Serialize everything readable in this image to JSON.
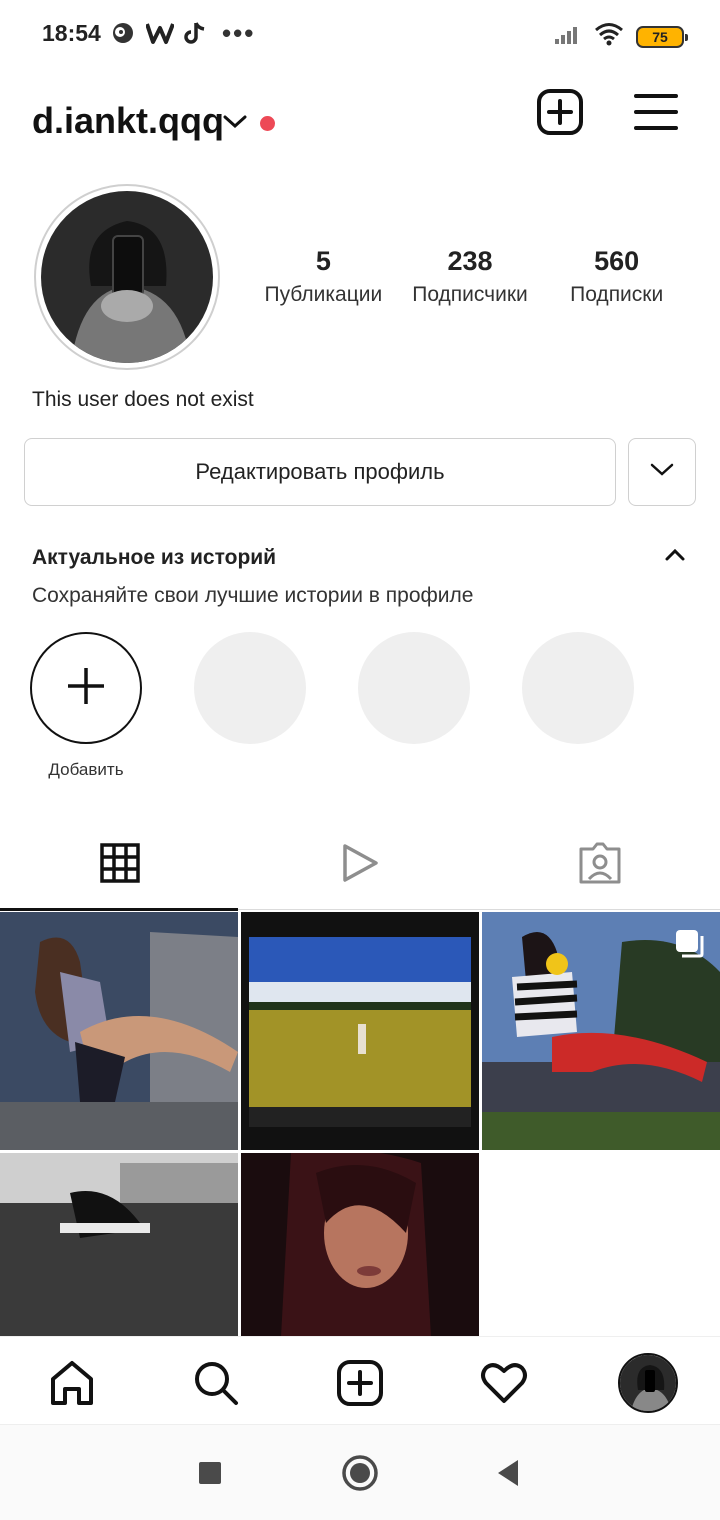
{
  "status_bar": {
    "time": "18:54",
    "battery": "75",
    "icons": [
      "moon-icon",
      "w-app-icon",
      "tiktok-icon",
      "more-dots-icon",
      "signal-icon",
      "wifi-icon",
      "battery-icon"
    ],
    "dots": "•••"
  },
  "header": {
    "username": "d.iankt.qqq",
    "icons": [
      "chevron-down-icon",
      "notification-dot",
      "add-post-icon",
      "menu-icon"
    ]
  },
  "profile": {
    "stats": [
      {
        "value": "5",
        "label": "Публикации"
      },
      {
        "value": "238",
        "label": "Подписчики"
      },
      {
        "value": "560",
        "label": "Подписки"
      }
    ],
    "bio": "This user does not exist",
    "edit_button": "Редактировать профиль"
  },
  "highlights": {
    "title": "Актуальное из историй",
    "subtitle": "Сохраняйте свои лучшие истории в профиле",
    "add_label": "Добавить"
  },
  "tabs": [
    {
      "name": "grid-icon",
      "active": true
    },
    {
      "name": "reels-icon",
      "active": false
    },
    {
      "name": "tagged-icon",
      "active": false
    }
  ],
  "bottom_nav": [
    "home-icon",
    "search-icon",
    "add-post-icon",
    "heart-icon",
    "profile-avatar"
  ],
  "system_nav": [
    "recents-icon",
    "home-button-icon",
    "back-icon"
  ],
  "colors": {
    "notification_dot": "#ed4956",
    "battery": "#ffb300",
    "highlight_empty": "#efefef",
    "divider": "#dbdbdb"
  }
}
